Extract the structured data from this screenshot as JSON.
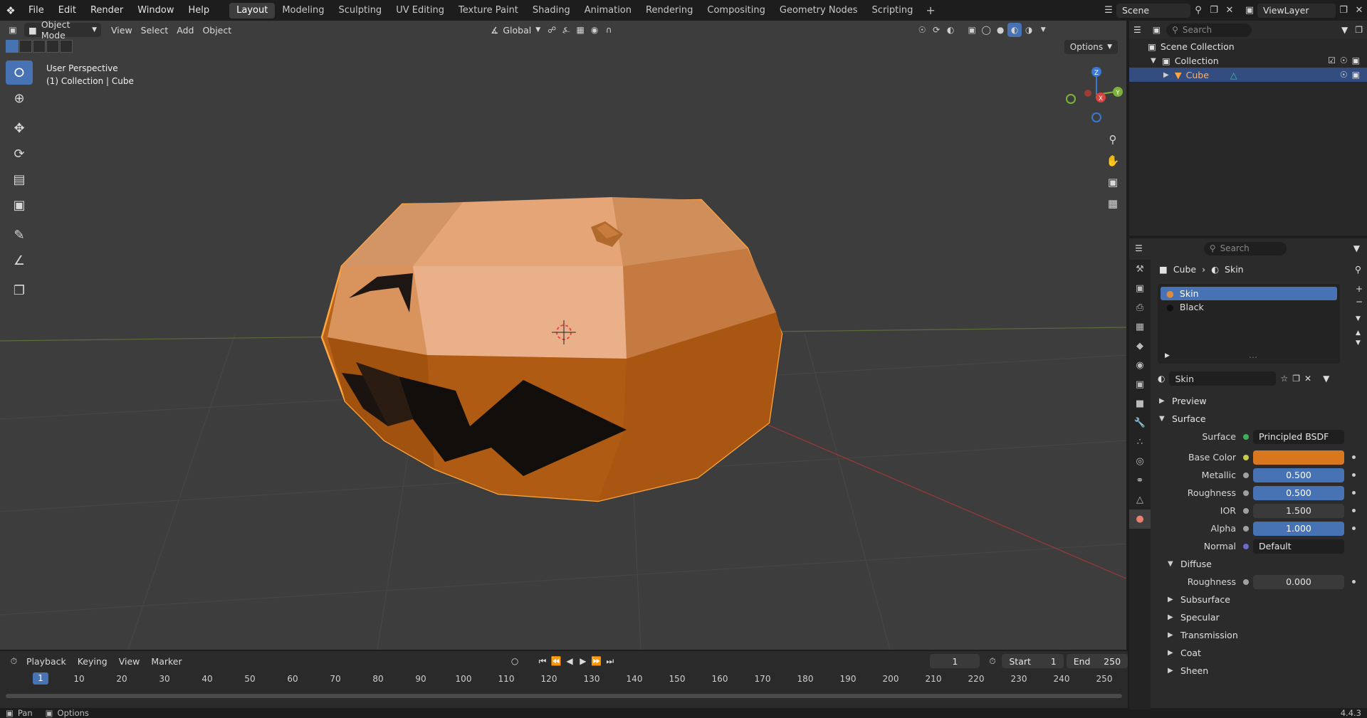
{
  "menu": [
    "File",
    "Edit",
    "Render",
    "Window",
    "Help"
  ],
  "workspaces": [
    "Layout",
    "Modeling",
    "Sculpting",
    "UV Editing",
    "Texture Paint",
    "Shading",
    "Animation",
    "Rendering",
    "Compositing",
    "Geometry Nodes",
    "Scripting"
  ],
  "active_workspace": "Layout",
  "scene_name": "Scene",
  "view_layer": "ViewLayer",
  "viewport": {
    "mode": "Object Mode",
    "menus": [
      "View",
      "Select",
      "Add",
      "Object"
    ],
    "orientation": "Global",
    "options_label": "Options",
    "overlay_line1": "User Perspective",
    "overlay_line2": "(1) Collection | Cube",
    "gizmo_axes": {
      "x": "X",
      "y": "Y",
      "z": "Z"
    }
  },
  "timeline": {
    "menus": [
      "Playback",
      "Keying",
      "View",
      "Marker"
    ],
    "current_frame": "1",
    "start_label": "Start",
    "start": "1",
    "end_label": "End",
    "end": "250",
    "ticks": [
      "10",
      "20",
      "30",
      "40",
      "50",
      "60",
      "70",
      "80",
      "90",
      "100",
      "110",
      "120",
      "130",
      "140",
      "150",
      "160",
      "170",
      "180",
      "190",
      "200",
      "210",
      "220",
      "230",
      "240",
      "250"
    ],
    "playhead_label": "1"
  },
  "statusbar": {
    "left1": "Pan",
    "left2": "Options",
    "version": "4.4.3"
  },
  "outliner": {
    "search_placeholder": "Search",
    "scene_collection": "Scene Collection",
    "collection": "Collection",
    "object": "Cube"
  },
  "properties": {
    "search_placeholder": "Search",
    "crumb_object": "Cube",
    "crumb_material": "Skin",
    "slots": [
      "Skin",
      "Black"
    ],
    "material_name": "Skin",
    "panels": {
      "preview": "Preview",
      "surface": "Surface"
    },
    "rows": [
      {
        "label": "Surface",
        "value": "Principled BSDF",
        "kind": "field",
        "dot": "#3fae5c"
      },
      {
        "label": "Base Color",
        "value": "",
        "kind": "color",
        "dot": "#c8c84a",
        "color": "#d9771f"
      },
      {
        "label": "Metallic",
        "value": "0.500",
        "kind": "slider",
        "dot": "#a0a0a0"
      },
      {
        "label": "Roughness",
        "value": "0.500",
        "kind": "slider",
        "dot": "#a0a0a0"
      },
      {
        "label": "IOR",
        "value": "1.500",
        "kind": "dark",
        "dot": "#a0a0a0"
      },
      {
        "label": "Alpha",
        "value": "1.000",
        "kind": "slider",
        "dot": "#a0a0a0"
      },
      {
        "label": "Normal",
        "value": "Default",
        "kind": "field",
        "dot": "#6a6ac8"
      }
    ],
    "diffuse": {
      "label": "Diffuse",
      "roughness_label": "Roughness",
      "roughness_value": "0.000"
    },
    "subpanels": [
      "Subsurface",
      "Specular",
      "Transmission",
      "Coat",
      "Sheen"
    ]
  },
  "colors": {
    "accent": "#4772b3",
    "object_orange": "#d9771f",
    "selection_outline": "#ffa640"
  }
}
